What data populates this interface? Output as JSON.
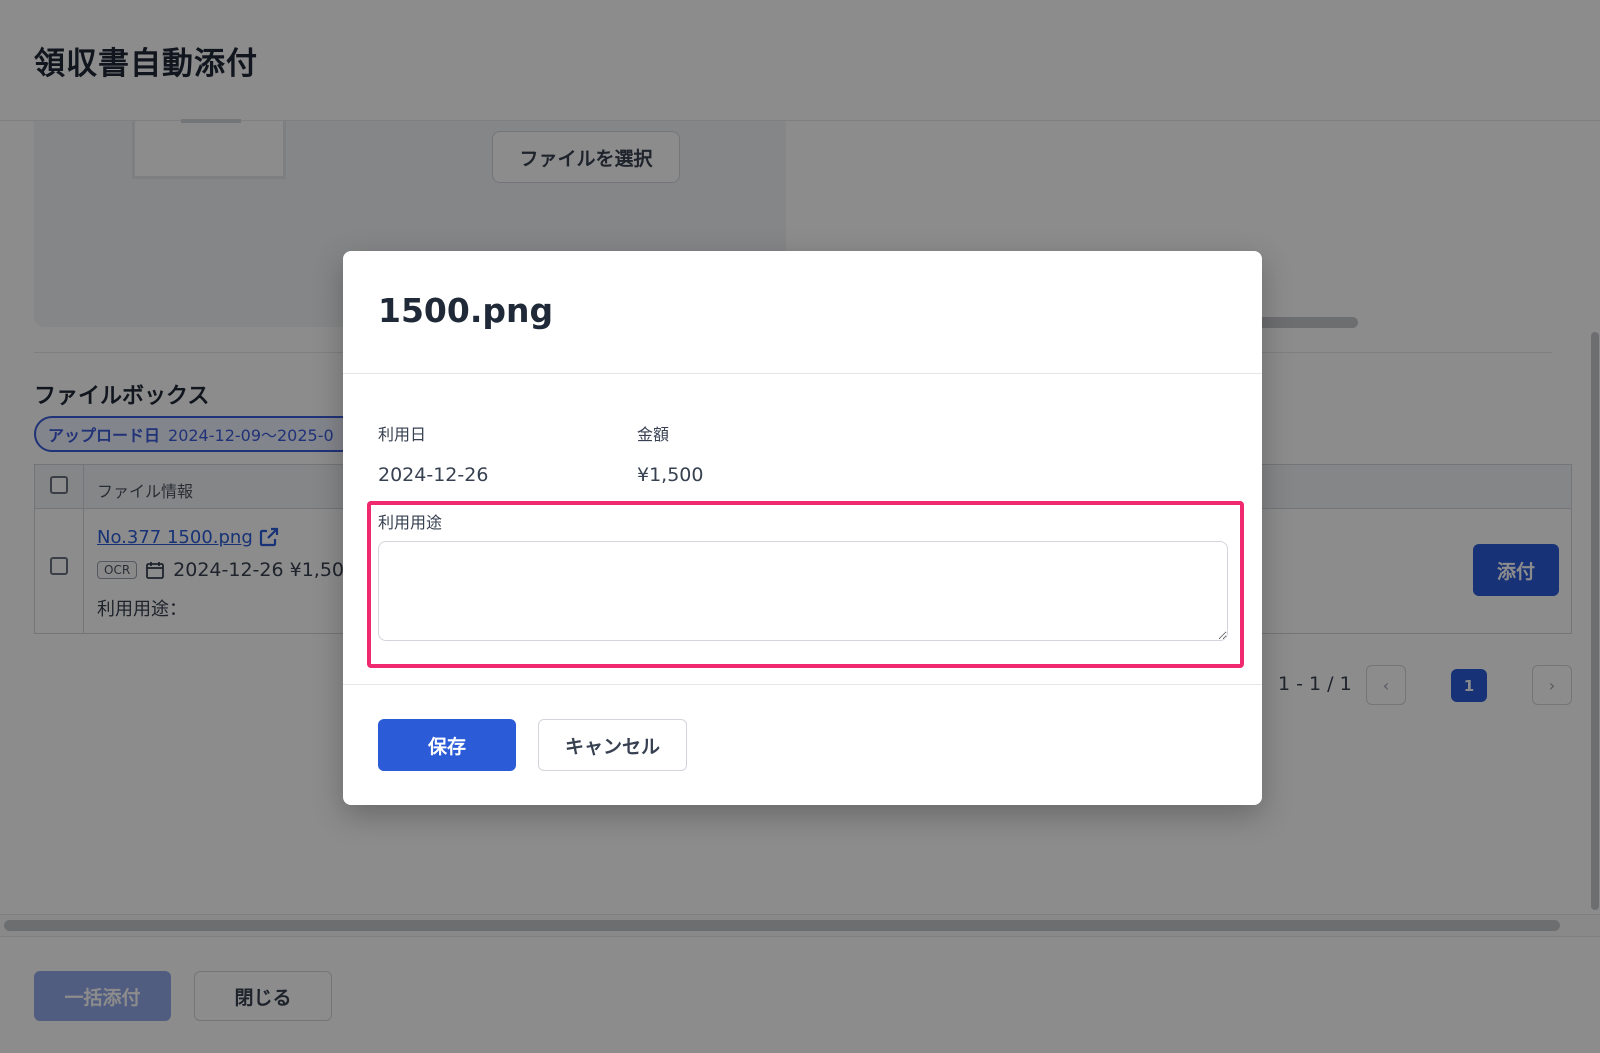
{
  "header": {
    "title": "領収書自動添付"
  },
  "upload": {
    "choose_file_label": "ファイルを選択"
  },
  "filebox": {
    "title": "ファイルボックス",
    "filter_chip": {
      "key": "アップロード日",
      "value": "2024-12-09〜2025-0"
    },
    "table": {
      "header_file_info": "ファイル情報",
      "rows": [
        {
          "file_name": "No.377 1500.png",
          "ocr_badge": "OCR",
          "date_amount": "2024-12-26 ¥1,50",
          "purpose": "利用用途：",
          "attach_label": "添付"
        }
      ]
    },
    "pagination": {
      "range": "1 - 1 / 1",
      "current": "1",
      "prev": "‹",
      "next": "›"
    }
  },
  "footer": {
    "bulk_attach_label": "一括添付",
    "close_label": "閉じる"
  },
  "modal": {
    "title": "1500.png",
    "date_label": "利用日",
    "date_value": "2024-12-26",
    "amount_label": "金額",
    "amount_value": "¥1,500",
    "purpose_label": "利用用途",
    "purpose_value": "",
    "save_label": "保存",
    "cancel_label": "キャンセル"
  },
  "colors": {
    "primary": "#2b5bd7",
    "highlight": "#f0286e",
    "overlay": "rgba(0,0,0,0.45)"
  }
}
